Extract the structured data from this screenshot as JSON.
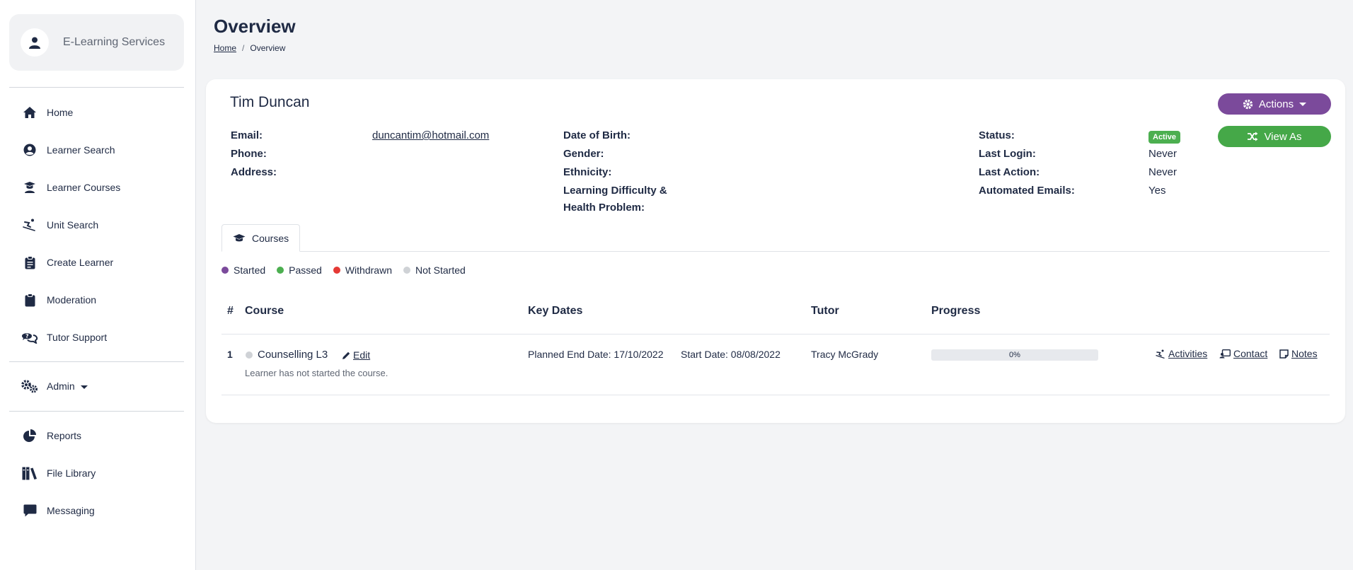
{
  "sidebar": {
    "brand": "E-Learning Services",
    "items": [
      {
        "label": "Home",
        "icon": "home-icon"
      },
      {
        "label": "Learner Search",
        "icon": "user-circle-icon"
      },
      {
        "label": "Learner Courses",
        "icon": "graduate-icon"
      },
      {
        "label": "Unit Search",
        "icon": "skiing-icon"
      },
      {
        "label": "Create Learner",
        "icon": "clipboard-icon"
      },
      {
        "label": "Moderation",
        "icon": "clipboard-check-icon"
      },
      {
        "label": "Tutor Support",
        "icon": "comments-question-icon"
      },
      {
        "label": "Admin",
        "icon": "cogs-icon"
      },
      {
        "label": "Reports",
        "icon": "pie-chart-icon"
      },
      {
        "label": "File Library",
        "icon": "books-icon"
      },
      {
        "label": "Messaging",
        "icon": "message-icon"
      }
    ]
  },
  "header": {
    "title": "Overview",
    "breadcrumb": {
      "home": "Home",
      "sep": "/",
      "current": "Overview"
    }
  },
  "learner": {
    "name": "Tim Duncan",
    "labels": {
      "email": "Email:",
      "phone": "Phone:",
      "address": "Address:",
      "dob": "Date of Birth:",
      "gender": "Gender:",
      "ethnicity": "Ethnicity:",
      "ldhp_line1": "Learning Difficulty &",
      "ldhp_line2": "Health Problem:",
      "status": "Status:",
      "last_login": "Last Login:",
      "last_action": "Last Action:",
      "auto_emails": "Automated Emails:"
    },
    "email": "duncantim@hotmail.com",
    "status": "Active",
    "last_login": "Never",
    "last_action": "Never",
    "auto_emails": "Yes"
  },
  "buttons": {
    "actions": "Actions",
    "view_as": "View As"
  },
  "tabs": {
    "courses": "Courses"
  },
  "legend": [
    {
      "label": "Started",
      "color": "#7b4a9b"
    },
    {
      "label": "Passed",
      "color": "#4caf50"
    },
    {
      "label": "Withdrawn",
      "color": "#e53935"
    },
    {
      "label": "Not Started",
      "color": "#cfd2d6"
    }
  ],
  "table": {
    "headers": {
      "num": "#",
      "course": "Course",
      "key_dates": "Key Dates",
      "tutor": "Tutor",
      "progress": "Progress"
    },
    "rows": [
      {
        "num": "1",
        "course": "Counselling L3",
        "edit": "Edit",
        "note": "Learner has not started the course.",
        "planned_end": "Planned End Date: 17/10/2022",
        "start": "Start Date: 08/08/2022",
        "tutor": "Tracy McGrady",
        "progress_value": 0,
        "progress_text": "0%",
        "activities": "Activities",
        "contact": "Contact",
        "notes": "Notes"
      }
    ]
  },
  "colors": {
    "purple": "#7b4a9b",
    "green": "#45a848",
    "navy": "#1f2a44"
  }
}
